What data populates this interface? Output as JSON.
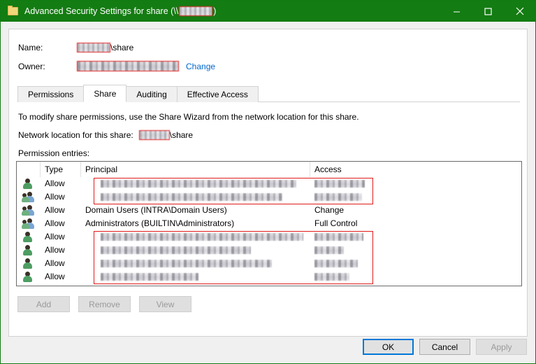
{
  "window": {
    "title_prefix": "Advanced Security Settings for share (\\\\",
    "title_suffix": ")",
    "title_icon": "folder-icon",
    "accent_color": "#137c12",
    "minimize_label": "Minimize",
    "maximize_label": "Maximize",
    "close_label": "Close"
  },
  "fields": {
    "name_label": "Name:",
    "name_suffix": "\\share",
    "owner_label": "Owner:",
    "owner_change_link": "Change"
  },
  "tabs": [
    {
      "label": "Permissions",
      "selected": false
    },
    {
      "label": "Share",
      "selected": true
    },
    {
      "label": "Auditing",
      "selected": false
    },
    {
      "label": "Effective Access",
      "selected": false
    }
  ],
  "share_tab": {
    "description": "To modify share permissions, use the Share Wizard from the network location for this share.",
    "network_location_label": "Network location for this share:",
    "network_location_suffix": "\\share",
    "permission_entries_label": "Permission entries:"
  },
  "table": {
    "columns": [
      "",
      "Type",
      "Principal",
      "Access"
    ],
    "rows": [
      {
        "icon": "user-icon",
        "type": "Allow",
        "principal": "",
        "principal_redacted": true,
        "access": "",
        "access_redacted": true
      },
      {
        "icon": "group-icon",
        "type": "Allow",
        "principal": "",
        "principal_redacted": true,
        "access": "",
        "access_redacted": true
      },
      {
        "icon": "group-icon",
        "type": "Allow",
        "principal": "Domain Users (INTRA\\Domain Users)",
        "principal_redacted": false,
        "access": "Change",
        "access_redacted": false
      },
      {
        "icon": "group-icon",
        "type": "Allow",
        "principal": "Administrators (BUILTIN\\Administrators)",
        "principal_redacted": false,
        "access": "Full Control",
        "access_redacted": false
      },
      {
        "icon": "user-icon",
        "type": "Allow",
        "principal": "",
        "principal_redacted": true,
        "access": "",
        "access_redacted": true
      },
      {
        "icon": "user-icon",
        "type": "Allow",
        "principal": "",
        "principal_redacted": true,
        "access": "",
        "access_redacted": true
      },
      {
        "icon": "user-icon",
        "type": "Allow",
        "principal": "",
        "principal_redacted": true,
        "access": "",
        "access_redacted": true
      },
      {
        "icon": "user-icon",
        "type": "Allow",
        "principal": "",
        "principal_redacted": true,
        "access": "",
        "access_redacted": true
      }
    ]
  },
  "entry_buttons": [
    {
      "label": "Add",
      "enabled": false
    },
    {
      "label": "Remove",
      "enabled": false
    },
    {
      "label": "View",
      "enabled": false
    }
  ],
  "footer_buttons": [
    {
      "label": "OK",
      "enabled": true,
      "default": true
    },
    {
      "label": "Cancel",
      "enabled": true,
      "default": false
    },
    {
      "label": "Apply",
      "enabled": false,
      "default": false
    }
  ]
}
